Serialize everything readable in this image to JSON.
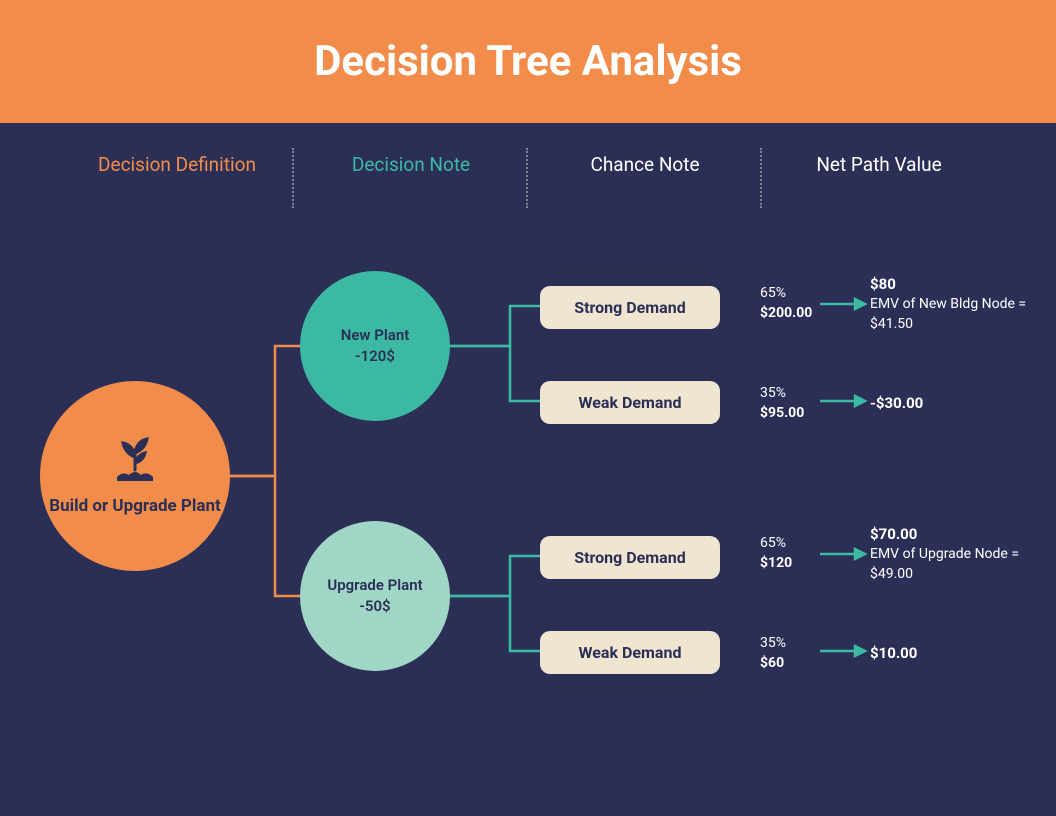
{
  "title": "Decision Tree Analysis",
  "legend": {
    "col1": "Decision Definition",
    "col2": "Decision Note",
    "col3": "Chance Note",
    "col4": "Net Path Value"
  },
  "root": {
    "label": "Build or Upgrade Plant"
  },
  "decisions": [
    {
      "name": "New Plant",
      "cost": "-120$"
    },
    {
      "name": "Upgrade Plant",
      "cost": "-50$"
    }
  ],
  "chances": [
    {
      "label": "Strong Demand",
      "prob": "65%",
      "value": "$200.00"
    },
    {
      "label": "Weak Demand",
      "prob": "35%",
      "value": "$95.00"
    },
    {
      "label": "Strong Demand",
      "prob": "65%",
      "value": "$120"
    },
    {
      "label": "Weak Demand",
      "prob": "35%",
      "value": "$60"
    }
  ],
  "nets": [
    {
      "main": "$80",
      "sub": "EMV of New Bldg Node = $41.50"
    },
    {
      "main": "-$30.00",
      "sub": ""
    },
    {
      "main": "$70.00",
      "sub": "EMV of Upgrade Node = $49.00"
    },
    {
      "main": "$10.00",
      "sub": ""
    }
  ],
  "colors": {
    "orange": "#f28c4a",
    "teal": "#3bb9a2",
    "mint": "#a0d6c5",
    "cream": "#f0e5d1",
    "navy": "#2b2f55"
  }
}
